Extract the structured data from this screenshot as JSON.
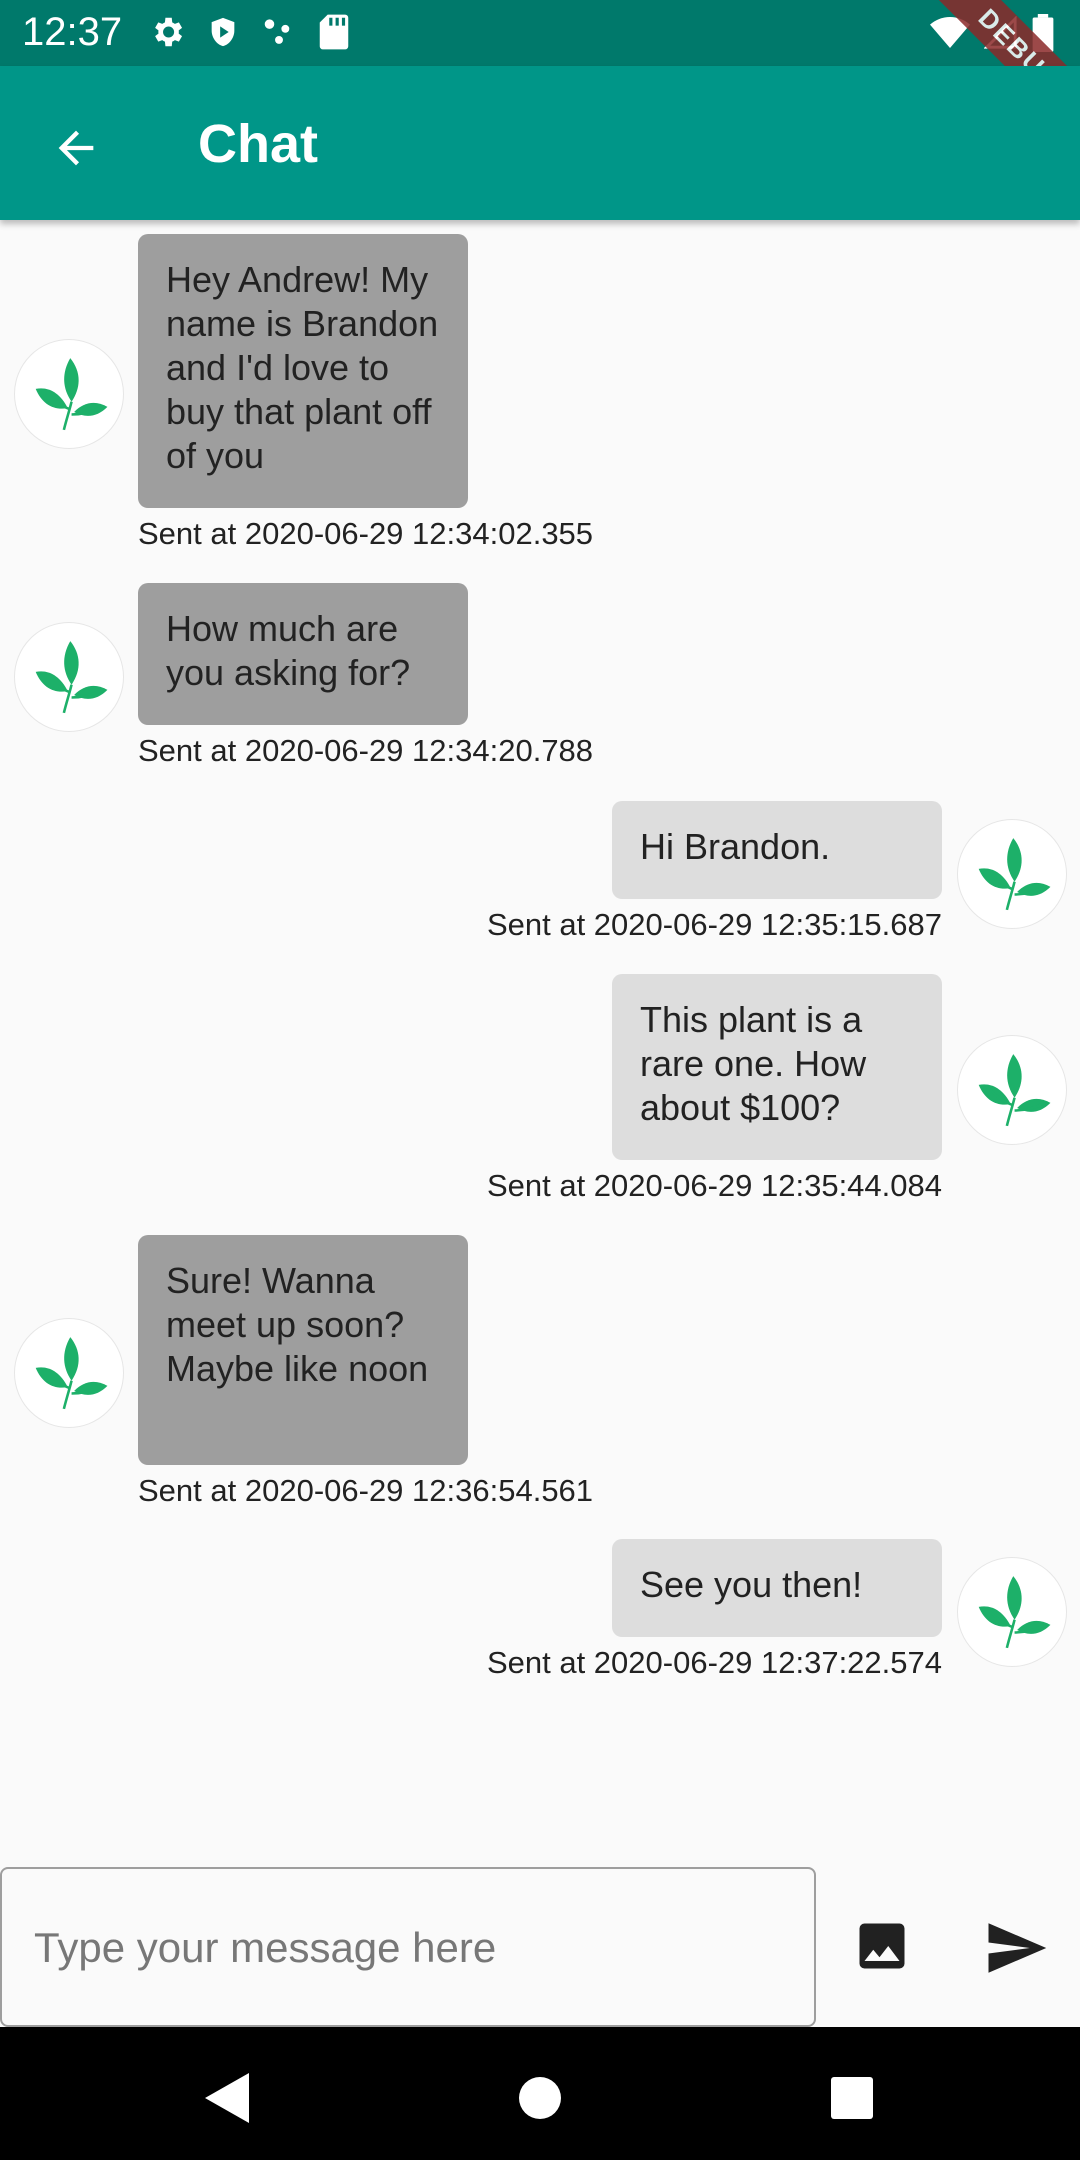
{
  "status_bar": {
    "time": "12:37",
    "left_icons": [
      "settings-icon",
      "shield-icon",
      "dots-icon",
      "sd-card-icon"
    ],
    "right_icons": [
      "wifi-icon",
      "signal-icon",
      "battery-icon"
    ],
    "debug_banner": "DEBUG"
  },
  "app_bar": {
    "title": "Chat",
    "back_icon": "arrow-back-icon"
  },
  "messages": [
    {
      "side": "incoming",
      "text": "Hey Andrew! My name is Brandon and I'd love to buy that plant off of you",
      "timestamp": "Sent at 2020-06-29 12:34:02.355"
    },
    {
      "side": "incoming",
      "text": "How much are you asking for?",
      "timestamp": "Sent at 2020-06-29 12:34:20.788"
    },
    {
      "side": "outgoing",
      "text": "Hi Brandon.",
      "timestamp": "Sent at 2020-06-29 12:35:15.687"
    },
    {
      "side": "outgoing",
      "text": "This plant is a rare one. How about $100?",
      "timestamp": "Sent at 2020-06-29 12:35:44.084"
    },
    {
      "side": "incoming",
      "text": "Sure! Wanna meet up soon? Maybe like noon",
      "timestamp": "Sent at 2020-06-29 12:36:54.561"
    },
    {
      "side": "outgoing",
      "text": "See you then!",
      "timestamp": "Sent at 2020-06-29 12:37:22.574"
    }
  ],
  "composer": {
    "placeholder": "Type your message here",
    "value": "",
    "image_icon": "image-icon",
    "send_icon": "send-icon"
  },
  "nav_bar": {
    "icons": [
      "back-triangle-icon",
      "home-circle-icon",
      "recents-square-icon"
    ]
  },
  "colors": {
    "status_bar": "#00796B",
    "app_bar": "#009688",
    "incoming_bubble": "#9E9E9E",
    "outgoing_bubble": "#DDDDDD",
    "leaf": "#1DB069"
  }
}
